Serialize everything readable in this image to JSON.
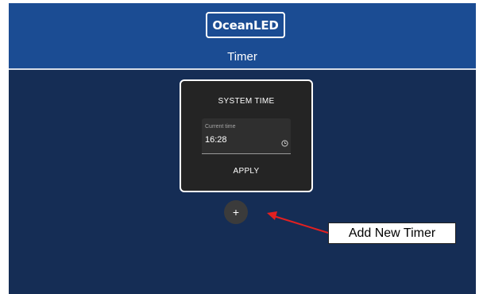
{
  "header": {
    "logo_text": "OceanLED",
    "title": "Timer"
  },
  "system_time_card": {
    "title": "SYSTEM TIME",
    "field_label": "Current time",
    "field_value": "16:28",
    "apply_label": "APPLY"
  },
  "add_button": {
    "label": "+"
  },
  "annotation": {
    "text": "Add New Timer"
  },
  "colors": {
    "header_bg": "#1b4c93",
    "page_bg": "#152d55",
    "card_bg": "#242424",
    "arrow": "#e32020"
  }
}
